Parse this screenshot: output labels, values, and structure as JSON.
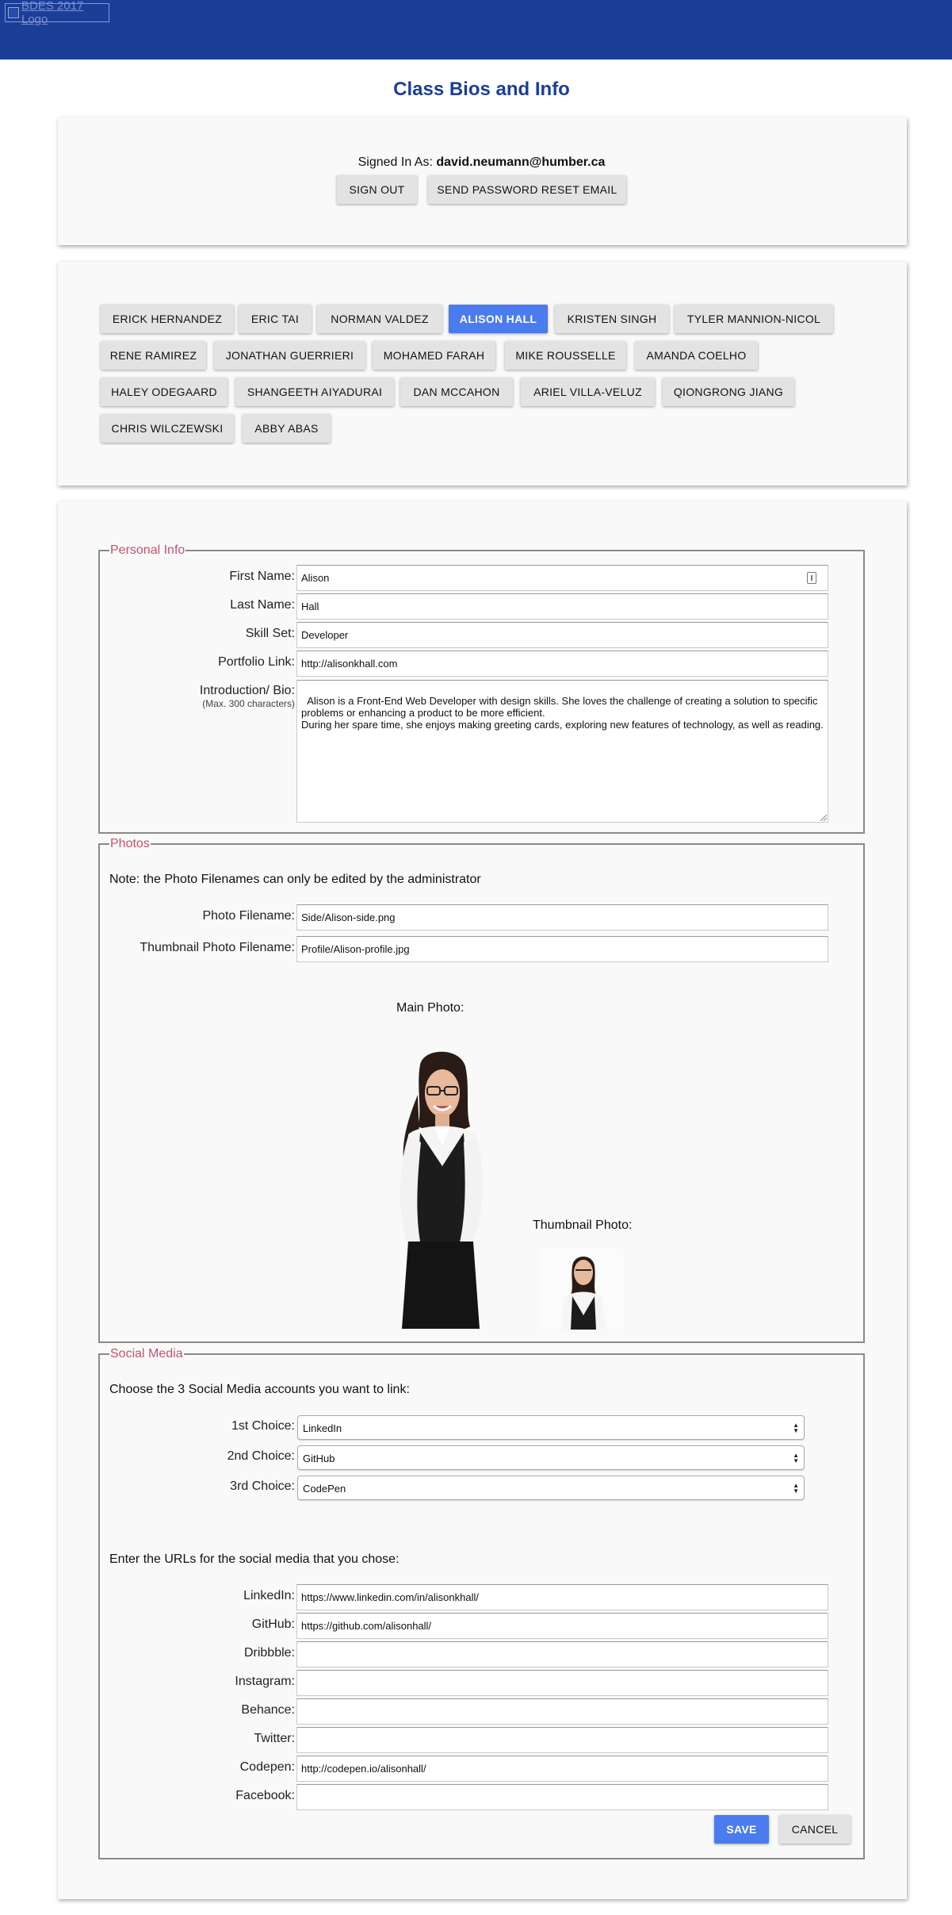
{
  "header": {
    "logo_alt": "BDES 2017 Logo",
    "brand_color": "#1b3e97"
  },
  "page_title": "Class Bios and Info",
  "account": {
    "signed_in_label": "Signed In As:",
    "email": "david.neumann@humber.ca",
    "sign_out_label": "SIGN OUT",
    "reset_label": "SEND PASSWORD RESET EMAIL"
  },
  "students": [
    "ERICK HERNANDEZ",
    "ERIC TAI",
    "NORMAN VALDEZ",
    "ALISON HALL",
    "KRISTEN SINGH",
    "TYLER MANNION-NICOL",
    "RENE RAMIREZ",
    "JONATHAN GUERRIERI",
    "MOHAMED FARAH",
    "MIKE ROUSSELLE",
    "AMANDA COELHO",
    "HALEY ODEGAARD",
    "SHANGEETH AIYADURAI",
    "DAN MCCAHON",
    "ARIEL VILLA-VELUZ",
    "QIONGRONG JIANG",
    "CHRIS WILCZEWSKI",
    "ABBY ABAS"
  ],
  "selected_student": "ALISON HALL",
  "personal": {
    "legend": "Personal Info",
    "first_name_label": "First Name:",
    "first_name": "Alison",
    "last_name_label": "Last Name:",
    "last_name": "Hall",
    "skill_label": "Skill Set:",
    "skill": "Developer",
    "portfolio_label": "Portfolio Link:",
    "portfolio": "http://alisonkhall.com",
    "bio_label": "Introduction/ Bio:",
    "bio_sub": "(Max. 300 characters)",
    "bio": "Alison is a Front-End Web Developer with design skills. She loves the challenge of creating a solution to specific problems or enhancing a product to be more efficient.\nDuring her spare time, she enjoys making greeting cards, exploring new features of technology, as well as reading."
  },
  "photos": {
    "legend": "Photos",
    "note": "Note: the Photo Filenames can only be edited by the administrator",
    "photo_label": "Photo Filename:",
    "photo": "Side/Alison-side.png",
    "thumb_label": "Thumbnail Photo Filename:",
    "thumb": "Profile/Alison-profile.jpg",
    "main_caption": "Main Photo:",
    "thumb_caption": "Thumbnail Photo:"
  },
  "social": {
    "legend": "Social Media",
    "choose_text": "Choose the 3 Social Media accounts you want to link:",
    "choice1_label": "1st Choice:",
    "choice1": "LinkedIn",
    "choice2_label": "2nd Choice:",
    "choice2": "GitHub",
    "choice3_label": "3rd Choice:",
    "choice3": "CodePen",
    "urls_text": "Enter the URLs for the social media that you chose:",
    "linkedin_label": "LinkedIn:",
    "linkedin": "https://www.linkedin.com/in/alisonkhall/",
    "github_label": "GitHub:",
    "github": "https://github.com/alisonhall/",
    "dribbble_label": "Dribbble:",
    "dribbble": "",
    "instagram_label": "Instagram:",
    "instagram": "",
    "behance_label": "Behance:",
    "behance": "",
    "twitter_label": "Twitter:",
    "twitter": "",
    "codepen_label": "Codepen:",
    "codepen": "http://codepen.io/alisonhall/",
    "facebook_label": "Facebook:",
    "facebook": ""
  },
  "actions": {
    "save_label": "SAVE",
    "cancel_label": "CANCEL",
    "accent": "#4a7bef",
    "legend_color": "#c7526c"
  }
}
